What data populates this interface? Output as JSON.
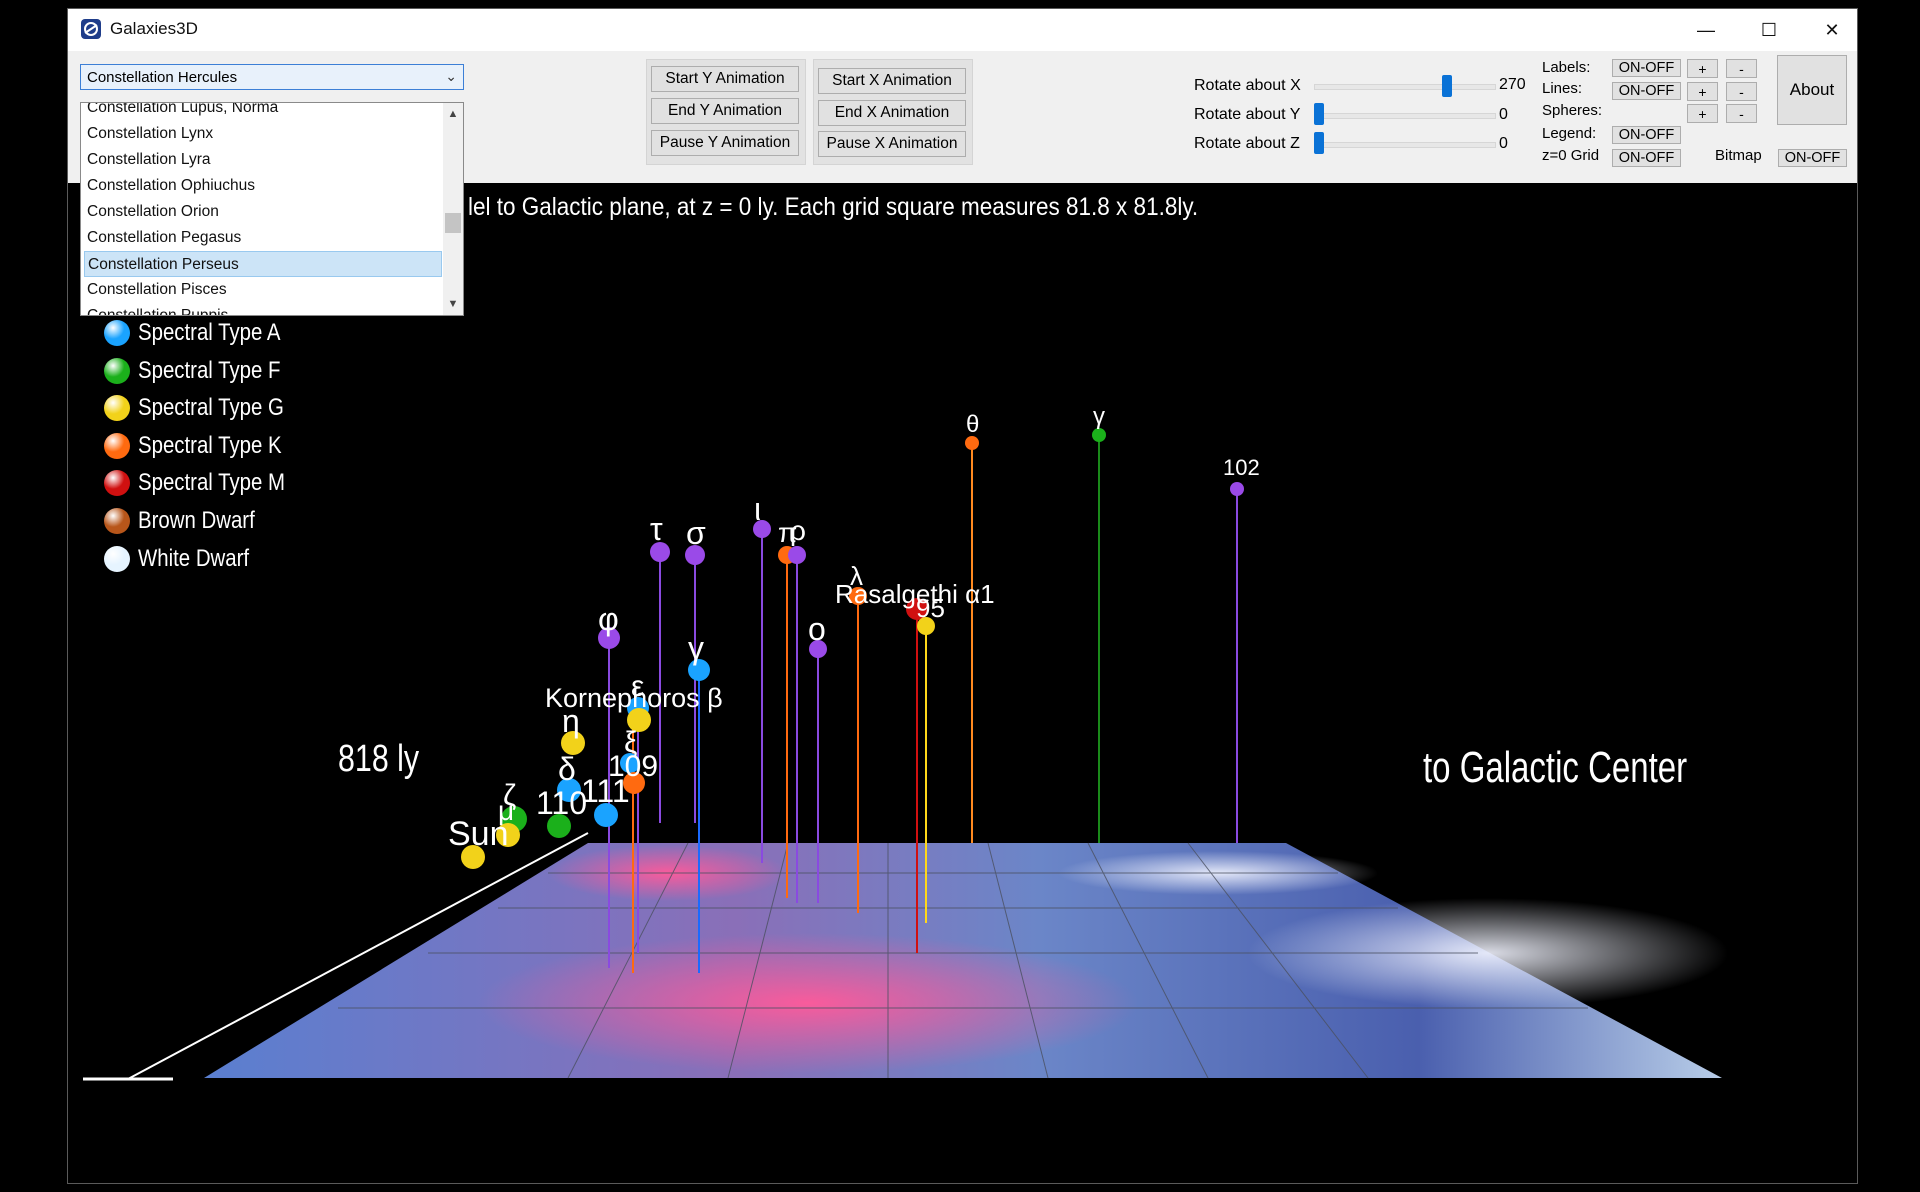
{
  "window": {
    "title": "Galaxies3D",
    "minimize": "—",
    "maximize": "☐",
    "close": "✕"
  },
  "constellation_select": {
    "selected": "Constellation Hercules",
    "options": [
      "Constellation Lupus, Norma",
      "Constellation Lynx",
      "Constellation Lyra",
      "Constellation Ophiuchus",
      "Constellation Orion",
      "Constellation Pegasus",
      "Constellation Perseus",
      "Constellation Pisces",
      "Constellation Puppis"
    ],
    "highlighted": "Constellation Perseus"
  },
  "animation": {
    "start_y": "Start Y Animation",
    "end_y": "End Y Animation",
    "pause_y": "Pause Y Animation",
    "start_x": "Start X Animation",
    "end_x": "End X Animation",
    "pause_x": "Pause X Animation"
  },
  "rotation": {
    "x_label": "Rotate about X",
    "x_value": "270",
    "x_level": 0.75,
    "y_label": "Rotate about Y",
    "y_value": "0",
    "y_level": 0,
    "z_label": "Rotate about Z",
    "z_value": "0",
    "z_level": 0
  },
  "toggles": {
    "labels": "Labels:",
    "lines": "Lines:",
    "spheres": "Spheres:",
    "legend": "Legend:",
    "grid": "z=0 Grid",
    "bitmap": "Bitmap",
    "on_off": "ON-OFF",
    "plus": "+",
    "minus": "-"
  },
  "about": "About",
  "scene": {
    "caption": "lel to Galactic plane, at z = 0 ly. Each grid square measures 81.8 x 81.8ly.",
    "legend": [
      {
        "label": "Spectral Type A",
        "color": "#1aa3ff"
      },
      {
        "label": "Spectral Type F",
        "color": "#1bb01b"
      },
      {
        "label": "Spectral Type G",
        "color": "#f2d21a"
      },
      {
        "label": "Spectral Type K",
        "color": "#ff6a10"
      },
      {
        "label": "Spectral Type M",
        "color": "#d01010"
      },
      {
        "label": "Brown Dwarf",
        "color": "#b8561a"
      },
      {
        "label": "White Dwarf",
        "color": "#e6f4ff"
      }
    ],
    "scale_label": "818 ly",
    "direction_label": "to Galactic Center",
    "star_labels": {
      "theta": "θ",
      "gamma_top": "γ",
      "n102": "102",
      "tau": "τ",
      "sigma": "σ",
      "iota": "ι",
      "pi": "π",
      "rho": "ρ",
      "lambda": "λ",
      "rasalgethi": "Rasalgethi α1",
      "n95": "95",
      "phi": "φ",
      "omicron": "ο",
      "gamma_low": "γ",
      "epsilon": "ε",
      "kornephoros": "Kornephoros β",
      "eta": "η",
      "xi": "ξ",
      "n109": "109",
      "delta": "δ",
      "n111": "111",
      "n110": "110",
      "zeta": "ζ",
      "mu": "μ",
      "sun": "Sun"
    }
  }
}
